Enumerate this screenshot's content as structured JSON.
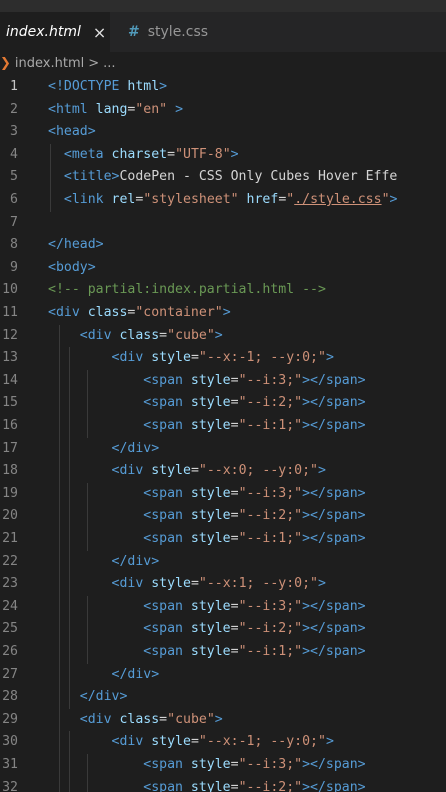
{
  "tabs": [
    {
      "label": "index.html",
      "close": "×"
    },
    {
      "icon": "#",
      "label": "style.css"
    }
  ],
  "breadcrumb": {
    "file": "index.html",
    "sep": ">",
    "more": "..."
  },
  "editor": {
    "lines": [
      {
        "n": "1",
        "t": [
          [
            "tag",
            "<!DOCTYPE "
          ],
          [
            "attr",
            "html"
          ],
          [
            "tag",
            ">"
          ]
        ]
      },
      {
        "n": "2",
        "t": [
          [
            "tag",
            "<html "
          ],
          [
            "attr",
            "lang"
          ],
          [
            "txt",
            "="
          ],
          [
            "str",
            "\"en\""
          ],
          [
            "tag",
            " >"
          ]
        ]
      },
      {
        "n": "3",
        "t": [
          [
            "tag",
            "<head>"
          ]
        ]
      },
      {
        "n": "4",
        "t": [
          [
            "txt",
            "  "
          ],
          [
            "tag",
            "<meta "
          ],
          [
            "attr",
            "charset"
          ],
          [
            "txt",
            "="
          ],
          [
            "str",
            "\"UTF-8\""
          ],
          [
            "tag",
            ">"
          ]
        ]
      },
      {
        "n": "5",
        "t": [
          [
            "txt",
            "  "
          ],
          [
            "tag",
            "<title>"
          ],
          [
            "txt",
            "CodePen - CSS Only Cubes Hover Effe"
          ]
        ]
      },
      {
        "n": "6",
        "t": [
          [
            "txt",
            "  "
          ],
          [
            "tag",
            "<link "
          ],
          [
            "attr",
            "rel"
          ],
          [
            "txt",
            "="
          ],
          [
            "str",
            "\"stylesheet\""
          ],
          [
            "txt",
            " "
          ],
          [
            "attr",
            "href"
          ],
          [
            "txt",
            "="
          ],
          [
            "str",
            "\""
          ],
          [
            "link",
            "./style.css"
          ],
          [
            "str",
            "\""
          ],
          [
            "tag",
            ">"
          ]
        ]
      },
      {
        "n": "7",
        "t": []
      },
      {
        "n": "8",
        "t": [
          [
            "tag",
            "</head>"
          ]
        ]
      },
      {
        "n": "9",
        "t": [
          [
            "tag",
            "<body>"
          ]
        ]
      },
      {
        "n": "10",
        "t": [
          [
            "com",
            "<!-- partial:index.partial.html -->"
          ]
        ]
      },
      {
        "n": "11",
        "t": [
          [
            "tag",
            "<div "
          ],
          [
            "attr",
            "class"
          ],
          [
            "txt",
            "="
          ],
          [
            "str",
            "\"container\""
          ],
          [
            "tag",
            ">"
          ]
        ]
      },
      {
        "n": "12",
        "t": [
          [
            "txt",
            "    "
          ],
          [
            "tag",
            "<div "
          ],
          [
            "attr",
            "class"
          ],
          [
            "txt",
            "="
          ],
          [
            "str",
            "\"cube\""
          ],
          [
            "tag",
            ">"
          ]
        ]
      },
      {
        "n": "13",
        "t": [
          [
            "txt",
            "        "
          ],
          [
            "tag",
            "<div "
          ],
          [
            "attr",
            "style"
          ],
          [
            "txt",
            "="
          ],
          [
            "str",
            "\"--x:-1; --y:0;\""
          ],
          [
            "tag",
            ">"
          ]
        ]
      },
      {
        "n": "14",
        "t": [
          [
            "txt",
            "            "
          ],
          [
            "tag",
            "<span "
          ],
          [
            "attr",
            "style"
          ],
          [
            "txt",
            "="
          ],
          [
            "str",
            "\"--i:3;\""
          ],
          [
            "tag",
            "></span>"
          ]
        ]
      },
      {
        "n": "15",
        "t": [
          [
            "txt",
            "            "
          ],
          [
            "tag",
            "<span "
          ],
          [
            "attr",
            "style"
          ],
          [
            "txt",
            "="
          ],
          [
            "str",
            "\"--i:2;\""
          ],
          [
            "tag",
            "></span>"
          ]
        ]
      },
      {
        "n": "16",
        "t": [
          [
            "txt",
            "            "
          ],
          [
            "tag",
            "<span "
          ],
          [
            "attr",
            "style"
          ],
          [
            "txt",
            "="
          ],
          [
            "str",
            "\"--i:1;\""
          ],
          [
            "tag",
            "></span>"
          ]
        ]
      },
      {
        "n": "17",
        "t": [
          [
            "txt",
            "        "
          ],
          [
            "tag",
            "</div>"
          ]
        ]
      },
      {
        "n": "18",
        "t": [
          [
            "txt",
            "        "
          ],
          [
            "tag",
            "<div "
          ],
          [
            "attr",
            "style"
          ],
          [
            "txt",
            "="
          ],
          [
            "str",
            "\"--x:0; --y:0;\""
          ],
          [
            "tag",
            ">"
          ]
        ]
      },
      {
        "n": "19",
        "t": [
          [
            "txt",
            "            "
          ],
          [
            "tag",
            "<span "
          ],
          [
            "attr",
            "style"
          ],
          [
            "txt",
            "="
          ],
          [
            "str",
            "\"--i:3;\""
          ],
          [
            "tag",
            "></span>"
          ]
        ]
      },
      {
        "n": "20",
        "t": [
          [
            "txt",
            "            "
          ],
          [
            "tag",
            "<span "
          ],
          [
            "attr",
            "style"
          ],
          [
            "txt",
            "="
          ],
          [
            "str",
            "\"--i:2;\""
          ],
          [
            "tag",
            "></span>"
          ]
        ]
      },
      {
        "n": "21",
        "t": [
          [
            "txt",
            "            "
          ],
          [
            "tag",
            "<span "
          ],
          [
            "attr",
            "style"
          ],
          [
            "txt",
            "="
          ],
          [
            "str",
            "\"--i:1;\""
          ],
          [
            "tag",
            "></span>"
          ]
        ]
      },
      {
        "n": "22",
        "t": [
          [
            "txt",
            "        "
          ],
          [
            "tag",
            "</div>"
          ]
        ]
      },
      {
        "n": "23",
        "t": [
          [
            "txt",
            "        "
          ],
          [
            "tag",
            "<div "
          ],
          [
            "attr",
            "style"
          ],
          [
            "txt",
            "="
          ],
          [
            "str",
            "\"--x:1; --y:0;\""
          ],
          [
            "tag",
            ">"
          ]
        ]
      },
      {
        "n": "24",
        "t": [
          [
            "txt",
            "            "
          ],
          [
            "tag",
            "<span "
          ],
          [
            "attr",
            "style"
          ],
          [
            "txt",
            "="
          ],
          [
            "str",
            "\"--i:3;\""
          ],
          [
            "tag",
            "></span>"
          ]
        ]
      },
      {
        "n": "25",
        "t": [
          [
            "txt",
            "            "
          ],
          [
            "tag",
            "<span "
          ],
          [
            "attr",
            "style"
          ],
          [
            "txt",
            "="
          ],
          [
            "str",
            "\"--i:2;\""
          ],
          [
            "tag",
            "></span>"
          ]
        ]
      },
      {
        "n": "26",
        "t": [
          [
            "txt",
            "            "
          ],
          [
            "tag",
            "<span "
          ],
          [
            "attr",
            "style"
          ],
          [
            "txt",
            "="
          ],
          [
            "str",
            "\"--i:1;\""
          ],
          [
            "tag",
            "></span>"
          ]
        ]
      },
      {
        "n": "27",
        "t": [
          [
            "txt",
            "        "
          ],
          [
            "tag",
            "</div>"
          ]
        ]
      },
      {
        "n": "28",
        "t": [
          [
            "txt",
            "    "
          ],
          [
            "tag",
            "</div>"
          ]
        ]
      },
      {
        "n": "29",
        "t": [
          [
            "txt",
            "    "
          ],
          [
            "tag",
            "<div "
          ],
          [
            "attr",
            "class"
          ],
          [
            "txt",
            "="
          ],
          [
            "str",
            "\"cube\""
          ],
          [
            "tag",
            ">"
          ]
        ]
      },
      {
        "n": "30",
        "t": [
          [
            "txt",
            "        "
          ],
          [
            "tag",
            "<div "
          ],
          [
            "attr",
            "style"
          ],
          [
            "txt",
            "="
          ],
          [
            "str",
            "\"--x:-1; --y:0;\""
          ],
          [
            "tag",
            ">"
          ]
        ]
      },
      {
        "n": "31",
        "t": [
          [
            "txt",
            "            "
          ],
          [
            "tag",
            "<span "
          ],
          [
            "attr",
            "style"
          ],
          [
            "txt",
            "="
          ],
          [
            "str",
            "\"--i:3;\""
          ],
          [
            "tag",
            "></span>"
          ]
        ]
      },
      {
        "n": "32",
        "t": [
          [
            "txt",
            "            "
          ],
          [
            "tag",
            "<span "
          ],
          [
            "attr",
            "style"
          ],
          [
            "txt",
            "="
          ],
          [
            "str",
            "\"--i:2;\""
          ],
          [
            "tag",
            "></span>"
          ]
        ]
      }
    ]
  },
  "colors": {
    "background": "#1e1e1e",
    "tag": "#569cd6",
    "attribute": "#9cdcfe",
    "string": "#ce9178",
    "comment": "#6a9955",
    "css_icon": "#519aba",
    "html_icon": "#e37933"
  }
}
